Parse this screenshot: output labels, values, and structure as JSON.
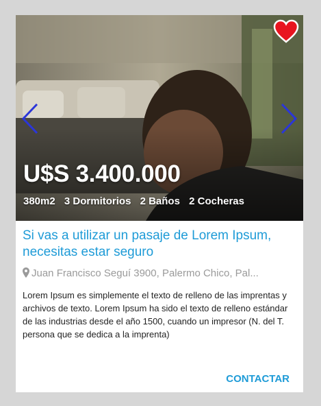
{
  "listing": {
    "price": "U$S 3.400.000",
    "features": [
      "380m2",
      "3 Dormitorios",
      "2 Baños",
      "2 Cocheras"
    ],
    "title": "Si vas a utilizar un pasaje de Lorem Ipsum, necesitas estar seguro",
    "address": "Juan Francisco Seguí 3900, Palermo Chico, Pal...",
    "description": "Lorem Ipsum es simplemente el texto de relleno de las imprentas y archivos de texto. Lorem Ipsum ha sido el texto de relleno estándar de las industrias desde el año 1500, cuando un impresor (N. del T. persona que se dedica a la imprenta)",
    "contact_label": "CONTACTAR"
  },
  "icons": {
    "favorite": "heart-icon",
    "prev": "chevron-left-icon",
    "next": "chevron-right-icon",
    "location": "map-pin-icon"
  },
  "colors": {
    "accent": "#1e9bd7",
    "heart": "#e8141f",
    "carousel_arrow": "#2b36d9",
    "background": "#d6d6d6"
  }
}
